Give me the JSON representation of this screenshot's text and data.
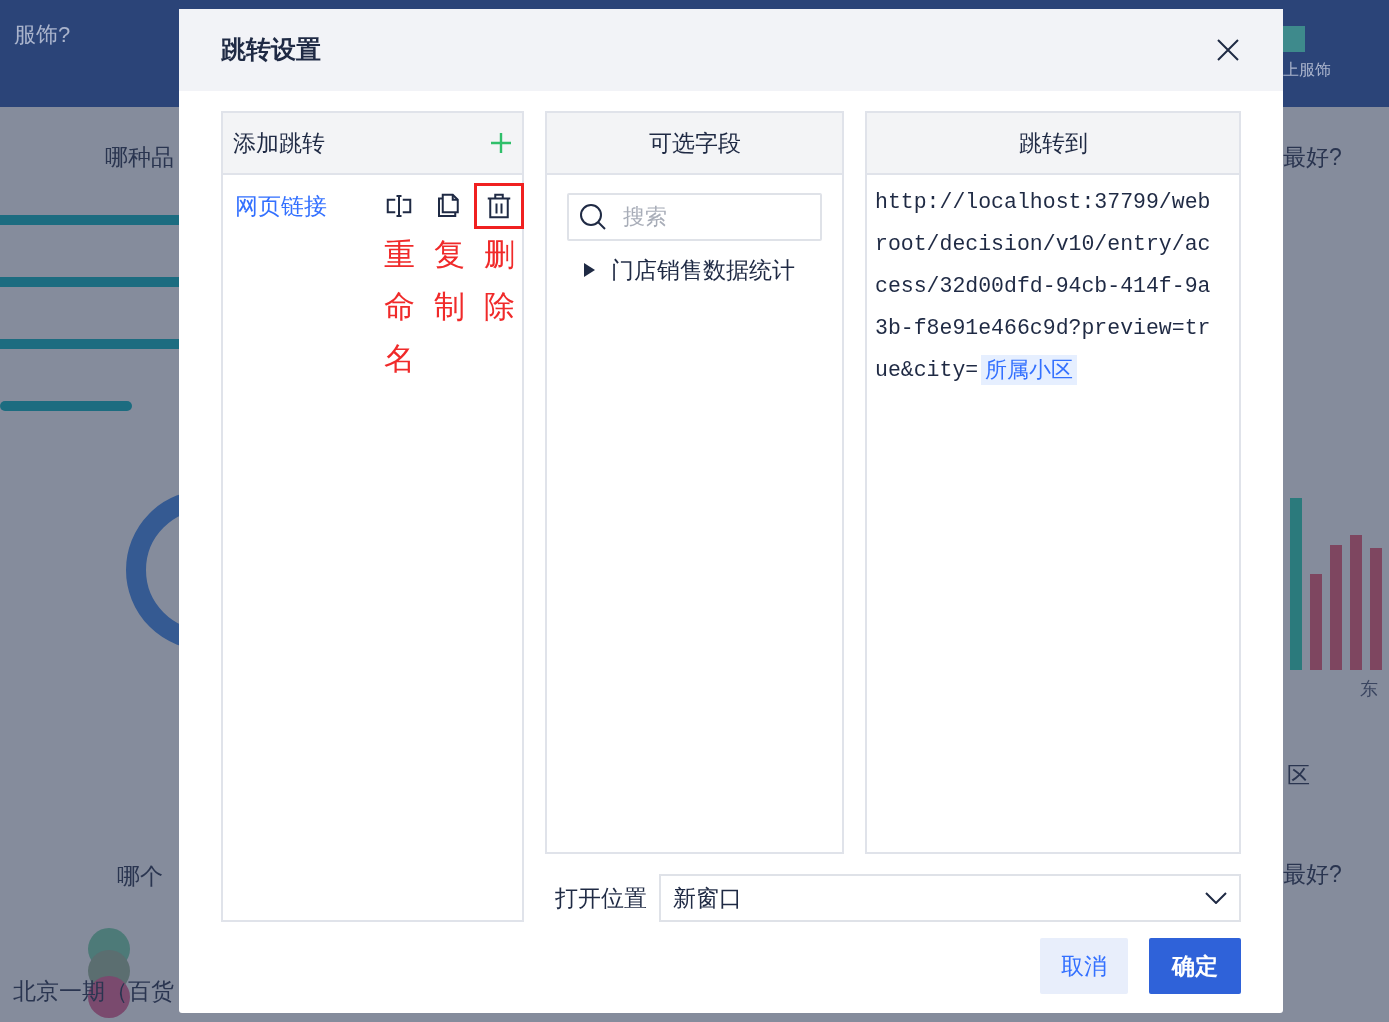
{
  "background": {
    "fragments": [
      {
        "text": "服饰?",
        "kind": "header"
      },
      {
        "text": "哪种品",
        "kind": "title"
      },
      {
        "text": "哪个",
        "kind": "title"
      },
      {
        "text": "北京一期（百货",
        "kind": "title"
      },
      {
        "text": "上服饰",
        "kind": "legend"
      },
      {
        "text": "最好?",
        "kind": "title"
      },
      {
        "text": "东",
        "kind": "axis"
      },
      {
        "text": "区",
        "kind": "title"
      },
      {
        "text": "最好?",
        "kind": "title"
      }
    ]
  },
  "dialog": {
    "title": "跳转设置",
    "jumps_panel": {
      "title": "添加跳转",
      "items": [
        {
          "label": "网页链接",
          "selected": true,
          "actions": [
            {
              "kind": "rename",
              "annotation": "重命名",
              "highlighted": false
            },
            {
              "kind": "copy",
              "annotation": "复制",
              "highlighted": false
            },
            {
              "kind": "delete",
              "annotation": "删除",
              "highlighted": true
            }
          ]
        }
      ]
    },
    "fields_panel": {
      "title": "可选字段",
      "search": {
        "placeholder": "搜索"
      },
      "tree": [
        {
          "label": "门店销售数据统计",
          "expanded": false
        }
      ]
    },
    "target_panel": {
      "title": "跳转到",
      "url_lines": [
        "http://localhost:37799/web",
        "root/decision/v10/entry/ac",
        "cess/32d00dfd-94cb-414f-9a",
        "3b-f8e91e466c9d?preview=tr",
        "ue&city="
      ],
      "field_chip": "所属小区"
    },
    "open_location": {
      "label": "打开位置",
      "value": "新窗口"
    },
    "buttons": [
      {
        "label": "取消",
        "kind": "secondary"
      },
      {
        "label": "确定",
        "kind": "primary"
      }
    ]
  }
}
